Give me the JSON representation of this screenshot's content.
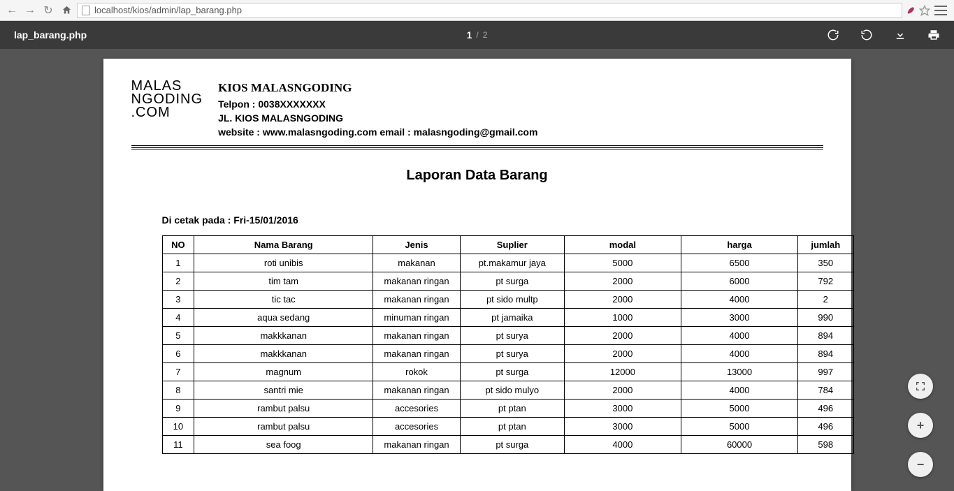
{
  "browser": {
    "url": "localhost/kios/admin/lap_barang.php"
  },
  "pdf": {
    "filename": "lap_barang.php",
    "current_page": "1",
    "total_pages": "2"
  },
  "doc": {
    "logo_l1": "MALAS",
    "logo_l2": "NGODING",
    "logo_l3": ".COM",
    "company": "KIOS MALASNGODING",
    "phone": "Telpon : 0038XXXXXXX",
    "address": "JL. KIOS MALASNGODING",
    "contact": "website : www.malasngoding.com email : malasngoding@gmail.com",
    "title": "Laporan Data Barang",
    "printed_on_label": "Di cetak pada : Fri-15/01/2016"
  },
  "chart_data": {
    "type": "table",
    "columns": [
      "NO",
      "Nama Barang",
      "Jenis",
      "Suplier",
      "modal",
      "harga",
      "jumlah"
    ],
    "rows": [
      [
        "1",
        "roti unibis",
        "makanan",
        "pt.makamur jaya",
        "5000",
        "6500",
        "350"
      ],
      [
        "2",
        "tim tam",
        "makanan ringan",
        "pt surga",
        "2000",
        "6000",
        "792"
      ],
      [
        "3",
        "tic tac",
        "makanan ringan",
        "pt sido multp",
        "2000",
        "4000",
        "2"
      ],
      [
        "4",
        "aqua sedang",
        "minuman ringan",
        "pt jamaika",
        "1000",
        "3000",
        "990"
      ],
      [
        "5",
        "makkkanan",
        "makanan ringan",
        "pt surya",
        "2000",
        "4000",
        "894"
      ],
      [
        "6",
        "makkkanan",
        "makanan ringan",
        "pt surya",
        "2000",
        "4000",
        "894"
      ],
      [
        "7",
        "magnum",
        "rokok",
        "pt surga",
        "12000",
        "13000",
        "997"
      ],
      [
        "8",
        "santri mie",
        "makanan ringan",
        "pt sido mulyo",
        "2000",
        "4000",
        "784"
      ],
      [
        "9",
        "rambut palsu",
        "accesories",
        "pt ptan",
        "3000",
        "5000",
        "496"
      ],
      [
        "10",
        "rambut palsu",
        "accesories",
        "pt ptan",
        "3000",
        "5000",
        "496"
      ],
      [
        "11",
        "sea foog",
        "makanan ringan",
        "pt surga",
        "4000",
        "60000",
        "598"
      ]
    ]
  }
}
